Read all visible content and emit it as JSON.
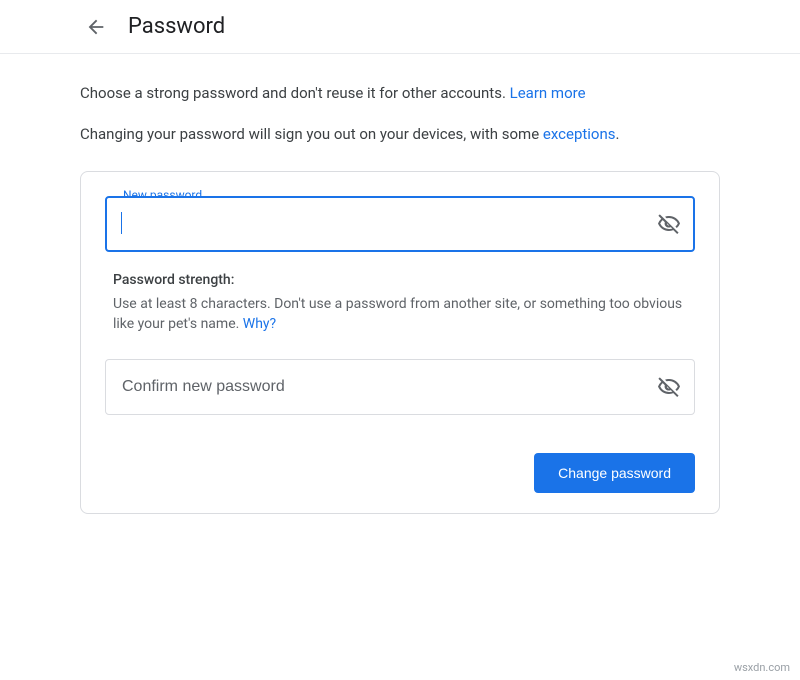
{
  "header": {
    "title": "Password"
  },
  "intro": {
    "line1_a": "Choose a strong password and don't reuse it for other accounts. ",
    "learn_more": "Learn more",
    "line2_a": "Changing your password will sign you out on your devices, with some ",
    "exceptions": "exceptions",
    "period": "."
  },
  "form": {
    "new_password_label": "New password",
    "confirm_placeholder": "Confirm new password",
    "strength_title": "Password strength:",
    "strength_hint": "Use at least 8 characters. Don't use a password from another site, or something too obvious like your pet's name. ",
    "why": "Why?",
    "submit": "Change password"
  },
  "watermark": "wsxdn.com"
}
